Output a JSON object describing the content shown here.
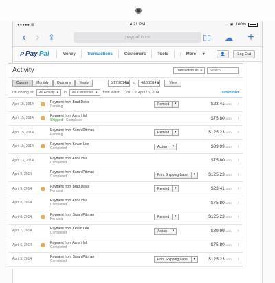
{
  "device": {
    "time": "4:21 PM",
    "battery": "100%",
    "url": "paypal.com"
  },
  "paypal": {
    "logo_a": "Pay",
    "logo_b": "Pal",
    "nav": [
      "Money",
      "Transactions",
      "Customers",
      "Tools",
      "More"
    ],
    "logout": "Log Out"
  },
  "activity": {
    "title": "Activity",
    "txn_id_select": "Transaction ID",
    "search_placeholder": "Search",
    "ranges": [
      "Custom",
      "Monthly",
      "Quarterly",
      "Yearly"
    ],
    "date_from": "5/17/2014",
    "to": "to",
    "date_to": "4/16/2014",
    "view": "View",
    "looking_for": "I'm looking for",
    "activity_filter": "All Activity",
    "in": "in",
    "currency_filter": "All Currencies",
    "range_text": "from March 17,2013 to April 16, 2014",
    "download": "Download"
  },
  "transactions": [
    {
      "date": "April 15, 2014",
      "name": "Payment from Brad Davis",
      "status": "Pending",
      "shipped": "",
      "action": "Remind",
      "amount": "$23.41",
      "currency": "USD",
      "doc": true
    },
    {
      "date": "April 15, 2014",
      "name": "Payment from Anna Hall",
      "status": "Completed",
      "shipped": "Shipped",
      "action": "",
      "amount": "$75.80",
      "currency": "USD",
      "doc": true
    },
    {
      "date": "April 15, 2014",
      "name": "Payment from Sarah Pittman",
      "status": "Pending",
      "shipped": "",
      "action": "Remind",
      "amount": "$125.23",
      "currency": "USD",
      "doc": false
    },
    {
      "date": "April 15, 2014",
      "name": "Payment from Kevan Lee",
      "status": "Completed",
      "shipped": "",
      "action": "Action",
      "amount": "$89.99",
      "currency": "USD",
      "doc": true
    },
    {
      "date": "April 13, 2014",
      "name": "Payment from Anna Hall",
      "status": "Completed",
      "shipped": "",
      "action": "",
      "amount": "$75.80",
      "currency": "USD",
      "doc": false
    },
    {
      "date": "April 9, 2014",
      "name": "Payment from Sarah Pittman",
      "status": "Completed",
      "shipped": "",
      "action": "Print Shipping Label",
      "amount": "$125.23",
      "currency": "USD",
      "doc": false
    },
    {
      "date": "April 9, 2014",
      "name": "Payment from Brad Davis",
      "status": "Pending",
      "shipped": "",
      "action": "Remind",
      "amount": "$23.41",
      "currency": "USD",
      "doc": true
    },
    {
      "date": "April 8, 2014",
      "name": "Payment from Anna Hall",
      "status": "Completed",
      "shipped": "",
      "action": "",
      "amount": "$75.80",
      "currency": "USD",
      "doc": false
    },
    {
      "date": "April 8, 2014",
      "name": "Payment from Sarah Pittman",
      "status": "Pending",
      "shipped": "",
      "action": "Remind",
      "amount": "$125.23",
      "currency": "USD",
      "doc": true
    },
    {
      "date": "April 7, 2014",
      "name": "Payment from Kevan Lee",
      "status": "Completed",
      "shipped": "",
      "action": "Action",
      "amount": "$89.99",
      "currency": "USD",
      "doc": false
    },
    {
      "date": "April 6, 2014",
      "name": "Payment from Anna Hall",
      "status": "Completed",
      "shipped": "",
      "action": "",
      "amount": "$75.80",
      "currency": "USD",
      "doc": true
    },
    {
      "date": "April 5, 2014",
      "name": "Payment from Sarah Pittman",
      "status": "Completed",
      "shipped": "",
      "action": "Print Shipping Label",
      "amount": "$125.23",
      "currency": "USD",
      "doc": false
    }
  ],
  "colors": {
    "accent": "#1b8fd4",
    "logo": "#1b3f8f",
    "pending_icon": "#f0ad4e",
    "shipped": "#3a9a35"
  }
}
